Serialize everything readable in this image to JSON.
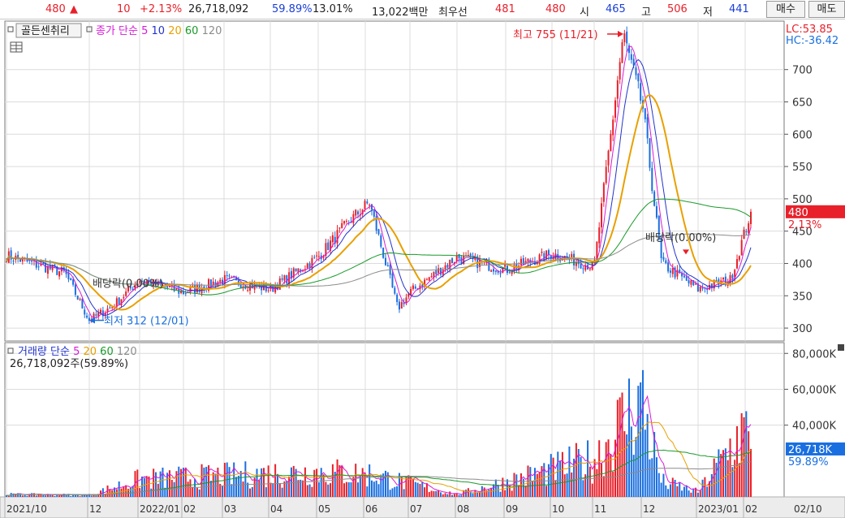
{
  "quote": {
    "price": "480",
    "change_arrow": "▲",
    "change": "10",
    "change_pct": "+2.13%",
    "volume": "26,718,092",
    "volume_ratio": "59.89%",
    "turnover": "13.01%",
    "amount": "13,022백만",
    "best_label": "최우선",
    "ask": "481",
    "bid": "480",
    "open_label": "시",
    "open": "465",
    "high_label": "고",
    "high": "506",
    "low_label": "저",
    "low": "441",
    "buy_button": "매수",
    "sell_button": "매도"
  },
  "toolbar": {
    "indicator_button": "골든센취리",
    "price_legend": {
      "prefix": "종가 단순",
      "periods": [
        "5",
        "10",
        "20",
        "60",
        "120"
      ]
    },
    "volume_legend": {
      "prefix": "거래량 단순",
      "periods": [
        "5",
        "20",
        "60",
        "120"
      ]
    },
    "volume_summary": "26,718,092주(59.89%)"
  },
  "colors": {
    "up": "#e8202a",
    "down": "#1a6fe0",
    "ma5": "#d81ad8",
    "ma10": "#2233cc",
    "ma20": "#e8a000",
    "ma60": "#1a9a2a",
    "ma120": "#8c8c8c"
  },
  "price_panel": {
    "lc_label": "LC:53.85",
    "hc_label": "HC:-36.42",
    "current_price_tag": "480",
    "current_change_tag": "2.13%",
    "high_annotation": "최고 755 (11/21)",
    "low_annotation": "최저 312 (12/01)",
    "dividend_annotation_1": "배당락(0.00%)",
    "dividend_annotation_2": "배당락(0.00%)"
  },
  "volume_panel": {
    "current_volume_tag": "26,718K",
    "current_ratio_tag": "59.89%"
  },
  "chart_data": [
    {
      "type": "candlestick",
      "title": "",
      "y_ticks": [
        300,
        350,
        400,
        450,
        500,
        550,
        600,
        650,
        700
      ],
      "ylim": [
        280,
        775
      ],
      "x_labels": [
        "2021/10",
        "12",
        "2022/01",
        "02",
        "03",
        "04",
        "05",
        "06",
        "07",
        "08",
        "09",
        "10",
        "11",
        "12",
        "2023/01",
        "02",
        "02/10"
      ],
      "grid": true,
      "last_close": 480,
      "highest": {
        "value": 755,
        "date": "11/21"
      },
      "lowest": {
        "value": 312,
        "date": "12/01"
      },
      "moving_averages": [
        "5",
        "10",
        "20",
        "60",
        "120"
      ],
      "series_approx_close": {
        "x": [
          "2021/10",
          "2021/11",
          "2021/12/01",
          "2021/12",
          "2022/01",
          "2022/02",
          "2022/03",
          "2022/04",
          "2022/05",
          "2022/05 end",
          "2022/06",
          "2022/06 end",
          "2022/07",
          "2022/08",
          "2022/09",
          "2022/10",
          "2022/11",
          "2022/11/21",
          "2022/12",
          "2022/12 end",
          "2023/01",
          "2023/02",
          "2023/02/10"
        ],
        "values": [
          412,
          385,
          312,
          335,
          375,
          355,
          375,
          360,
          410,
          465,
          495,
          330,
          355,
          410,
          390,
          415,
          395,
          755,
          640,
          400,
          360,
          375,
          480
        ]
      }
    },
    {
      "type": "bar",
      "title": "",
      "y_ticks": [
        40000,
        60000,
        80000
      ],
      "y_tick_labels": [
        "40,000K",
        "60,000K",
        "80,000K"
      ],
      "ylim": [
        0,
        86000
      ],
      "last_volume_k": 26718,
      "moving_averages": [
        "5",
        "20",
        "60",
        "120"
      ],
      "series_approx_volume_k": {
        "x": [
          "2021/10",
          "2021/12",
          "2022/01",
          "2022/05",
          "2022/06",
          "2022/08",
          "2022/11",
          "2022/11/21",
          "2022/12",
          "2023/01",
          "2023/02",
          "2023/02/10"
        ],
        "values": [
          2000,
          1500,
          14000,
          20000,
          18000,
          2000,
          30000,
          79000,
          12000,
          4000,
          55000,
          26718
        ]
      }
    }
  ]
}
